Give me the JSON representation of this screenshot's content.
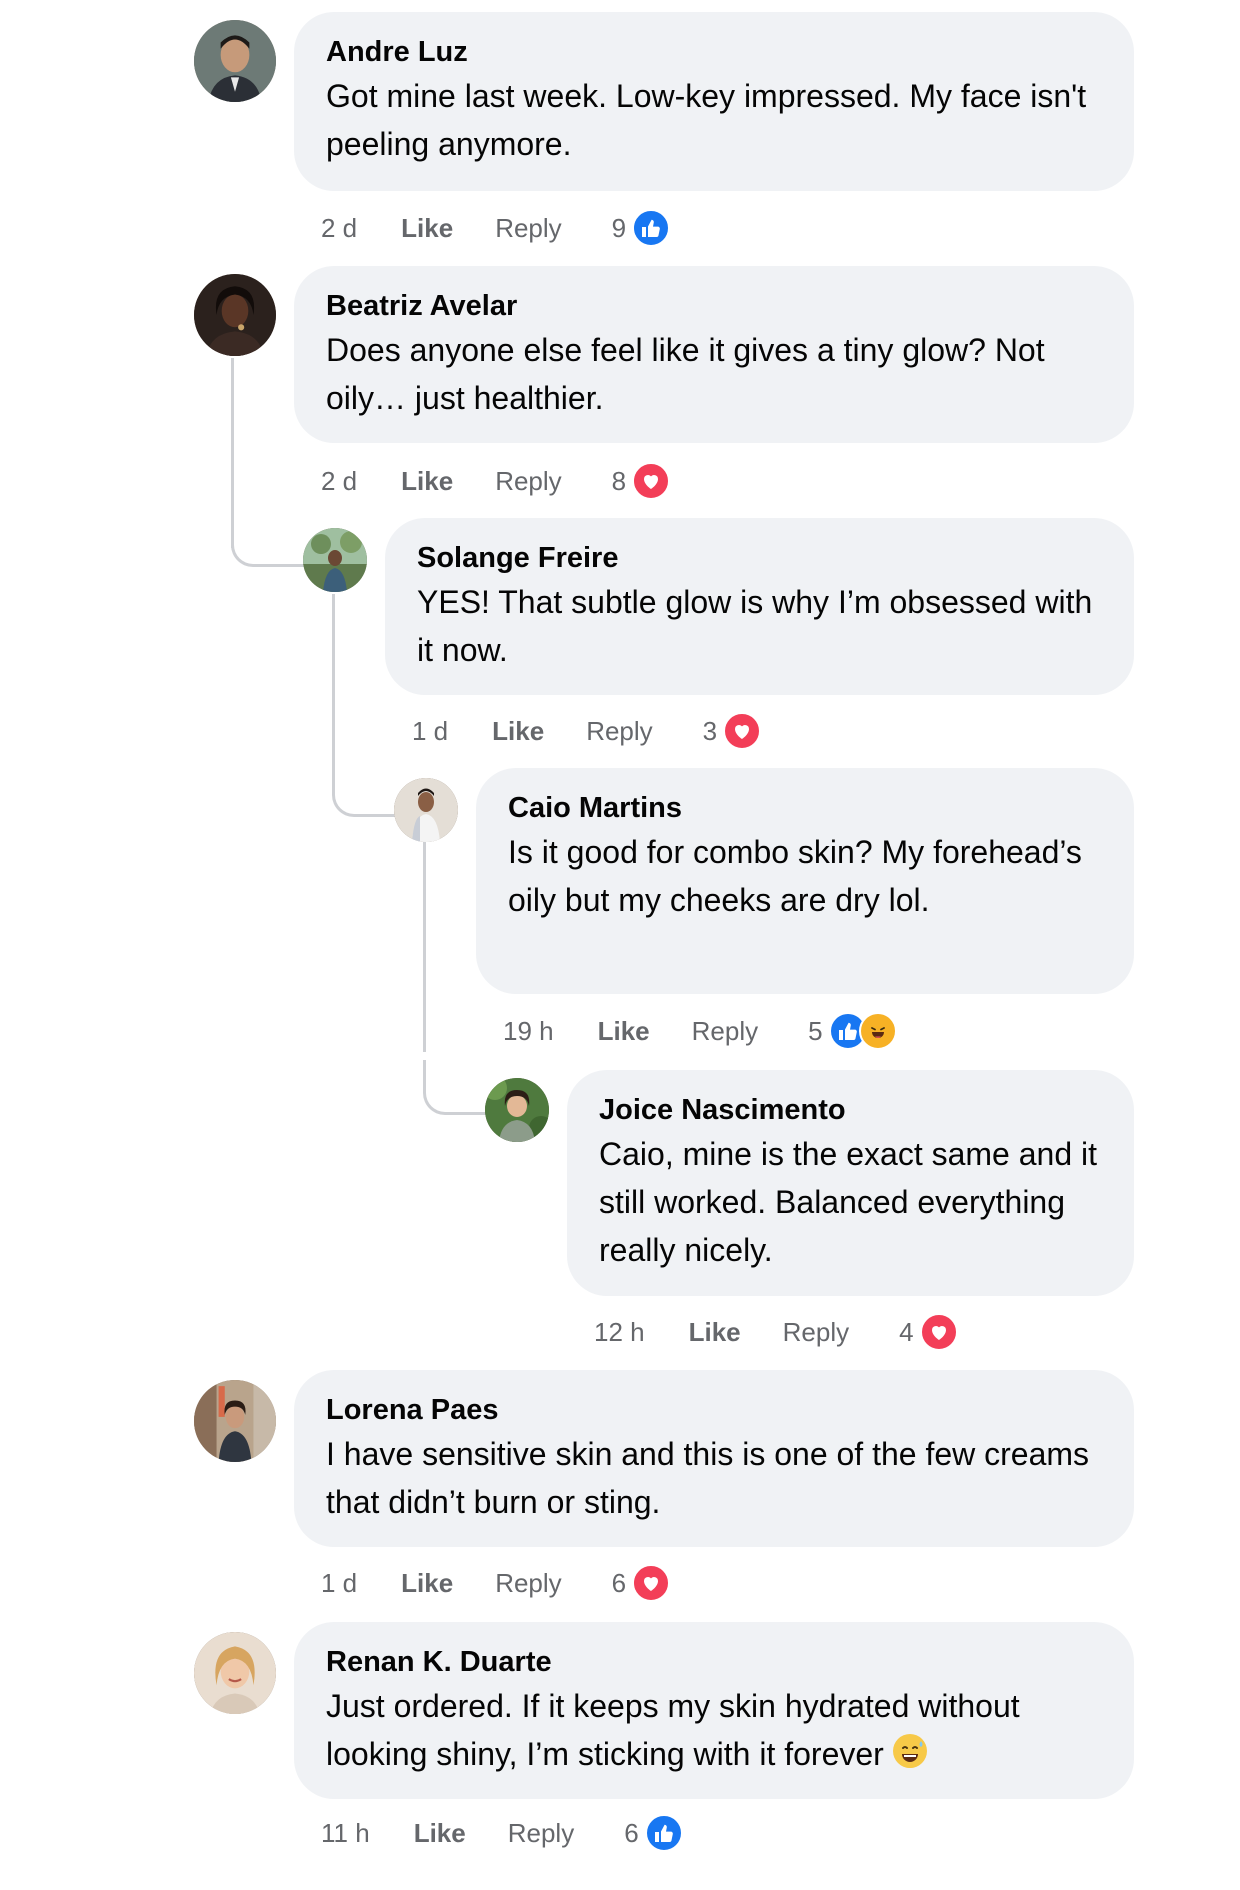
{
  "comments": [
    {
      "author": "Andre Luz",
      "text": "Got mine last week. Low-key impressed. My face isn't peeling anymore.",
      "time": "2 d",
      "like": "Like",
      "reply": "Reply",
      "count": "9",
      "reaction": "like-icon"
    },
    {
      "author": "Beatriz Avelar",
      "text": "Does anyone else feel like it gives a tiny glow? Not oily… just healthier.",
      "time": "2 d",
      "like": "Like",
      "reply": "Reply",
      "count": "8",
      "reaction": "love-icon"
    },
    {
      "author": "Solange Freire",
      "text": "YES! That subtle glow is why I’m obsessed with it now.",
      "time": "1 d",
      "like": "Like",
      "reply": "Reply",
      "count": "3",
      "reaction": "love-icon"
    },
    {
      "author": "Caio Martins",
      "text": "Is it good for combo skin? My forehead’s oily but my cheeks are dry lol.",
      "time": "19 h",
      "like": "Like",
      "reply": "Reply",
      "count": "5",
      "reaction": "like-icon, haha-icon"
    },
    {
      "author": "Joice Nascimento",
      "text": "Caio, mine is the exact same and it still worked. Balanced everything really nicely.",
      "time": "12 h",
      "like": "Like",
      "reply": "Reply",
      "count": "4",
      "reaction": "love-icon"
    },
    {
      "author": "Lorena Paes",
      "text": "I have sensitive skin and this is one of the few creams that didn’t burn or sting.",
      "time": "1 d",
      "like": "Like",
      "reply": "Reply",
      "count": "6",
      "reaction": "love-icon"
    },
    {
      "author": "Renan K. Duarte",
      "text": "Just ordered. If it keeps my skin hydrated without looking shiny, I’m sticking with it forever",
      "time": "11 h",
      "like": "Like",
      "reply": "Reply",
      "count": "6",
      "reaction": "like-icon",
      "trailing_emoji": "sweat-smile-emoji"
    }
  ],
  "colors": {
    "bubble": "#f0f2f5",
    "secondary_text": "#65676b",
    "like_blue": "#1877f2",
    "love_red": "#f33e58",
    "thread_line": "#ced0d4"
  }
}
